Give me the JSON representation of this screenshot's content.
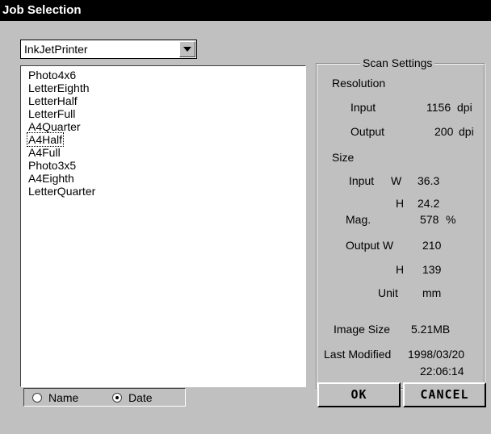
{
  "window": {
    "title": "Job Selection"
  },
  "printer_select": {
    "value": "InkJetPrinter"
  },
  "job_list": {
    "items": [
      "Photo4x6",
      "LetterEighth",
      "LetterHalf",
      "LetterFull",
      "A4Quarter",
      "A4Half",
      "A4Full",
      "Photo3x5",
      "A4Eighth",
      "LetterQuarter"
    ],
    "focused_index": 5
  },
  "scan_settings": {
    "legend": "Scan Settings",
    "resolution_label": "Resolution",
    "input_label": "Input",
    "input_value": "1156",
    "input_unit": "dpi",
    "output_label": "Output",
    "output_value": "200",
    "output_unit": "dpi",
    "size_label": "Size",
    "size_input_label": "Input",
    "w_label": "W",
    "size_input_w": "36.3",
    "h_label": "H",
    "size_input_h": "24.2",
    "mag_label": "Mag.",
    "mag_value": "578",
    "mag_unit": "%",
    "size_output_label": "Output W",
    "size_output_w": "210",
    "size_output_h_label": "H",
    "size_output_h": "139",
    "unit_label": "Unit",
    "unit_value": "mm",
    "image_size_label": "Image Size",
    "image_size_value": "5.21MB",
    "last_modified_label": "Last Modified",
    "last_modified_date": "1998/03/20",
    "last_modified_time": "22:06:14"
  },
  "sort": {
    "name_label": "Name",
    "date_label": "Date",
    "selected": "Date"
  },
  "buttons": {
    "ok": "OK",
    "cancel": "CANCEL"
  }
}
